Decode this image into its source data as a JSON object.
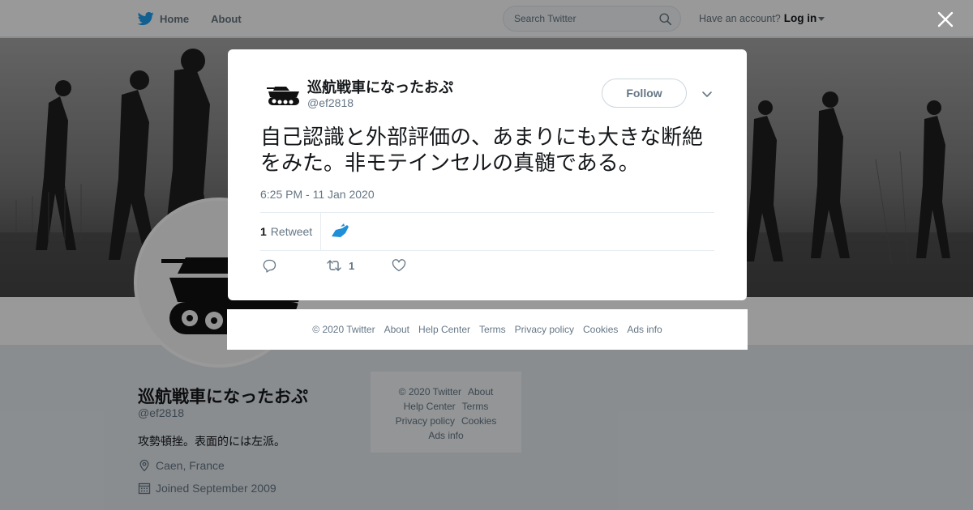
{
  "nav": {
    "home_label": "Home",
    "about_label": "About",
    "search_placeholder": "Search Twitter",
    "account_prompt": "Have an account?",
    "login_label": "Log in"
  },
  "profile": {
    "name": "巡航戦車になったおぷ",
    "handle": "@ef2818",
    "bio": "攻勢頓挫。表面的には左派。",
    "location": "Caen, France",
    "joined": "Joined September 2009"
  },
  "side_footer": {
    "copyright": "© 2020 Twitter",
    "about": "About",
    "help": "Help Center",
    "terms": "Terms",
    "privacy": "Privacy policy",
    "cookies": "Cookies",
    "ads": "Ads info"
  },
  "tweet": {
    "author_name": "巡航戦車になったおぷ",
    "author_handle": "@ef2818",
    "follow_label": "Follow",
    "text": "自己認識と外部評価の、あまりにも大きな断絶をみた。非モテインセルの真髄である。",
    "timestamp": "6:25 PM - 11 Jan 2020",
    "retweet_count": "1",
    "retweet_label": "Retweet",
    "action_retweet_count": "1"
  },
  "modal_footer": {
    "copyright": "© 2020 Twitter",
    "about": "About",
    "help": "Help Center",
    "terms": "Terms",
    "privacy": "Privacy policy",
    "cookies": "Cookies",
    "ads": "Ads info"
  },
  "colors": {
    "brand": "#1da1f2",
    "overlay": "rgba(0,0,0,0.4)",
    "muted": "#657786"
  }
}
